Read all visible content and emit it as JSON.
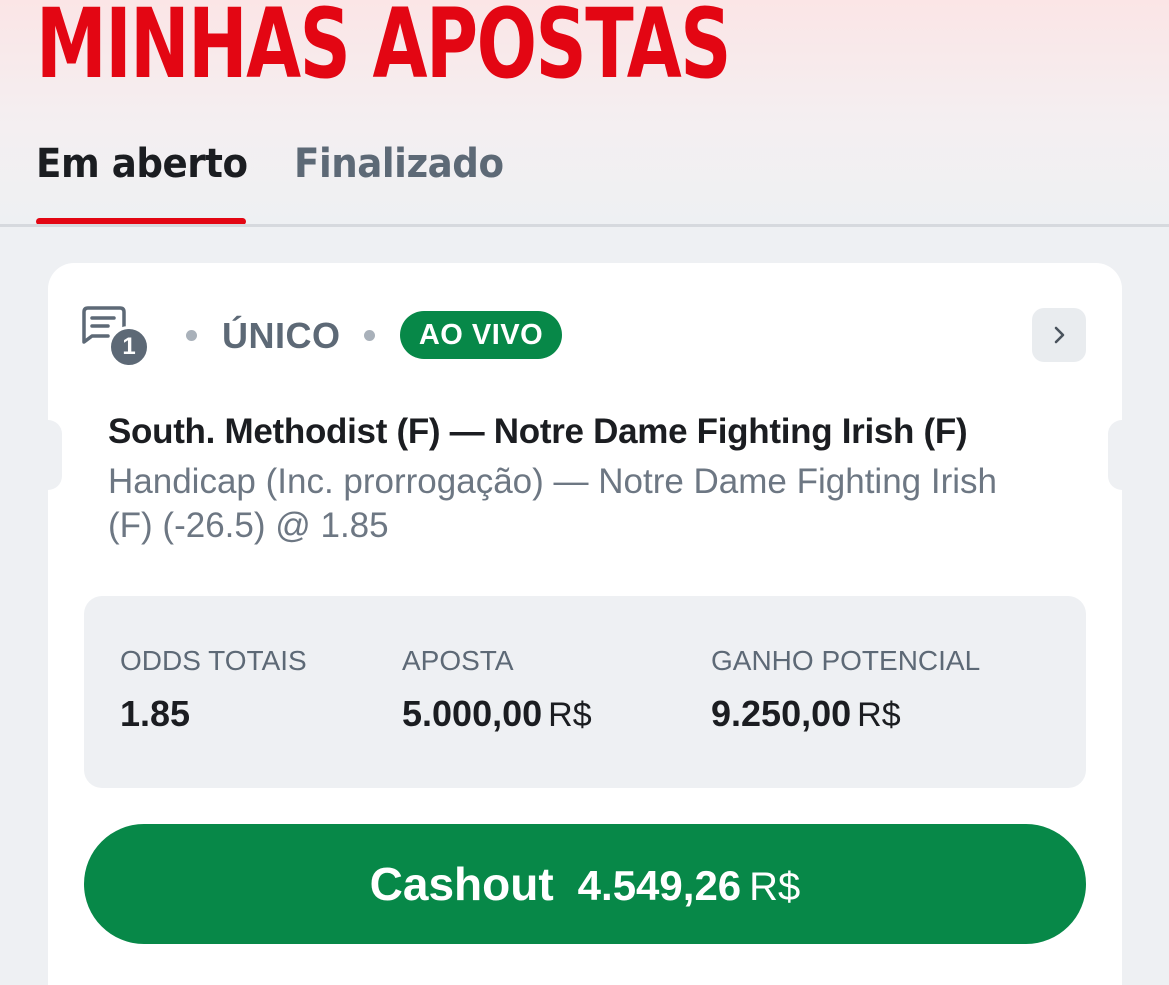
{
  "page": {
    "title": "MINHAS APOSTAS"
  },
  "tabs": [
    {
      "label": "Em aberto",
      "active": true
    },
    {
      "label": "Finalizado",
      "active": false
    }
  ],
  "colors": {
    "brand_red": "#e30613",
    "live_green": "#078848",
    "muted": "#5d6976"
  },
  "bet": {
    "selections_count": "1",
    "type": "ÚNICO",
    "status_badge": "AO VIVO",
    "event": "South. Methodist (F) — Notre Dame Fighting Irish (F)",
    "market": "Handicap (Inc. prorrogação) — Notre Dame Fighting Irish (F) (-26.5) @ 1.85",
    "stats": {
      "odds": {
        "label": "ODDS TOTAIS",
        "value": "1.85"
      },
      "stake": {
        "label": "APOSTA",
        "value": "5.000,00",
        "currency": "R$"
      },
      "potential_win": {
        "label": "GANHO POTENCIAL",
        "value": "9.250,00",
        "currency": "R$"
      }
    },
    "cashout": {
      "label": "Cashout",
      "amount": "4.549,26",
      "currency": "R$"
    }
  },
  "icons": {
    "ticket": "ticket-icon",
    "chevron": "chevron-right-icon"
  }
}
